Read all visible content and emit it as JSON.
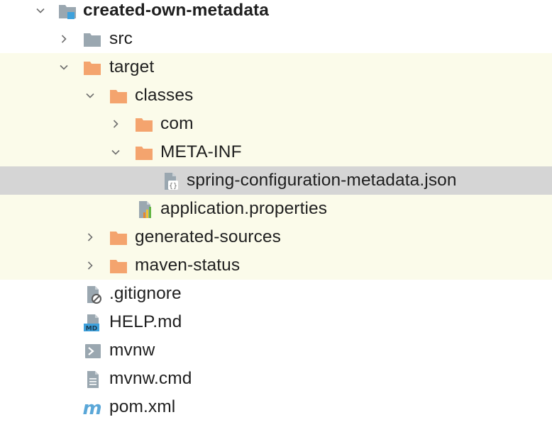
{
  "project_tree": {
    "root": {
      "label": "created-own-metadata",
      "icon": "module-folder-icon",
      "expanded": true
    },
    "items": [
      {
        "label": "src",
        "icon": "folder-gray-icon",
        "expanded": false
      },
      {
        "label": "target",
        "icon": "folder-orange-icon",
        "expanded": true,
        "excluded": true
      },
      {
        "label": "classes",
        "icon": "folder-orange-icon",
        "expanded": true,
        "excluded": true
      },
      {
        "label": "com",
        "icon": "folder-orange-icon",
        "expanded": false,
        "excluded": true
      },
      {
        "label": "META-INF",
        "icon": "folder-orange-icon",
        "expanded": true,
        "excluded": true
      },
      {
        "label": "spring-configuration-metadata.json",
        "icon": "json-file-icon",
        "selected": true
      },
      {
        "label": "application.properties",
        "icon": "properties-file-icon",
        "excluded": true
      },
      {
        "label": "generated-sources",
        "icon": "folder-orange-icon",
        "expanded": false,
        "excluded": true
      },
      {
        "label": "maven-status",
        "icon": "folder-orange-icon",
        "expanded": false,
        "excluded": true
      },
      {
        "label": ".gitignore",
        "icon": "gitignore-file-icon"
      },
      {
        "label": "HELP.md",
        "icon": "markdown-file-icon"
      },
      {
        "label": "mvnw",
        "icon": "shell-script-icon"
      },
      {
        "label": "mvnw.cmd",
        "icon": "text-file-icon"
      },
      {
        "label": "pom.xml",
        "icon": "maven-pom-icon"
      }
    ]
  },
  "colors": {
    "excluded_background": "#fbfbea",
    "selected_background": "#d5d5d5",
    "folder_orange": "#f4a46e",
    "folder_gray": "#9aa7b0",
    "module_blue": "#3ea1dc",
    "maven_blue": "#5aa7d8"
  }
}
